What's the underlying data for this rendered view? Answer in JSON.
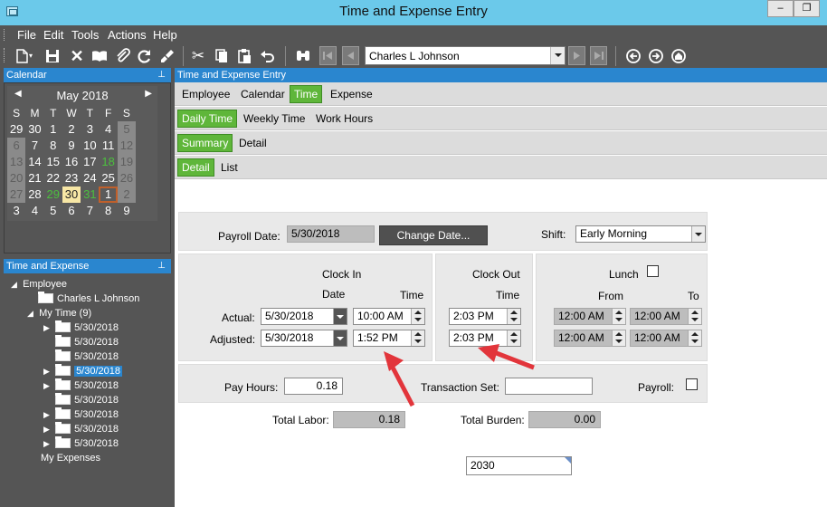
{
  "window": {
    "title": "Time and Expense Entry",
    "minimize": "–",
    "restore": "❐"
  },
  "menu": [
    "File",
    "Edit",
    "Tools",
    "Actions",
    "Help"
  ],
  "toolbar": {
    "employee": "Charles L Johnson"
  },
  "calendar_panel": {
    "title": "Calendar",
    "month": "May 2018",
    "weekdays": [
      "S",
      "M",
      "T",
      "W",
      "T",
      "F",
      "S"
    ],
    "weeks": [
      [
        "29",
        "30",
        "1",
        "2",
        "3",
        "4",
        "5"
      ],
      [
        "6",
        "7",
        "8",
        "9",
        "10",
        "11",
        "12"
      ],
      [
        "13",
        "14",
        "15",
        "16",
        "17",
        "18",
        "19"
      ],
      [
        "20",
        "21",
        "22",
        "23",
        "24",
        "25",
        "26"
      ],
      [
        "27",
        "28",
        "29",
        "30",
        "31",
        "1",
        "2"
      ],
      [
        "3",
        "4",
        "5",
        "6",
        "7",
        "8",
        "9"
      ]
    ]
  },
  "tree_panel": {
    "title": "Time and Expense",
    "root": "Employee",
    "employee": "Charles L Johnson",
    "my_time": "My Time (9)",
    "entries": [
      "5/30/2018",
      "5/30/2018",
      "5/30/2018",
      "5/30/2018",
      "5/30/2018",
      "5/30/2018",
      "5/30/2018",
      "5/30/2018",
      "5/30/2018"
    ],
    "my_expenses": "My Expenses"
  },
  "main": {
    "header": "Time and Expense Entry",
    "tabs1": [
      "Employee",
      "Calendar",
      "Time",
      "Expense"
    ],
    "tabs2": [
      "Daily Time",
      "Weekly Time",
      "Work Hours"
    ],
    "tabs3": [
      "Summary",
      "Detail"
    ],
    "tabs4": [
      "Detail",
      "List"
    ],
    "payroll_date_label": "Payroll Date:",
    "payroll_date": "5/30/2018",
    "change_date": "Change Date...",
    "shift_label": "Shift:",
    "shift": "Early Morning",
    "clock_in": "Clock In",
    "clock_out": "Clock Out",
    "lunch": "Lunch",
    "date_hdr": "Date",
    "time_hdr": "Time",
    "time_hdr2": "Time",
    "from_hdr": "From",
    "to_hdr": "To",
    "actual_label": "Actual:",
    "adjusted_label": "Adjusted:",
    "actual_date": "5/30/2018",
    "adjusted_date": "5/30/2018",
    "actual_in": "10:00 AM",
    "adjusted_in": "1:52 PM",
    "actual_out": "2:03 PM",
    "adjusted_out": "2:03 PM",
    "lunch_actual_from": "12:00 AM",
    "lunch_actual_to": "12:00 AM",
    "lunch_adj_from": "12:00 AM",
    "lunch_adj_to": "12:00 AM",
    "pay_hours_label": "Pay Hours:",
    "pay_hours": "0.18",
    "transaction_set_label": "Transaction Set:",
    "transaction_set": "",
    "payroll_label": "Payroll:",
    "total_labor_label": "Total Labor:",
    "total_labor": "0.18",
    "total_burden_label": "Total Burden:",
    "total_burden": "0.00",
    "code": "2030"
  }
}
